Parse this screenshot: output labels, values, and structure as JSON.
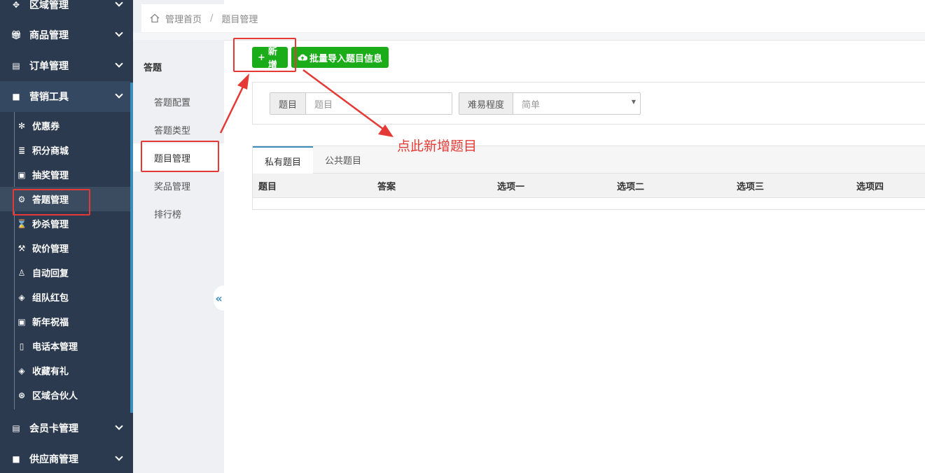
{
  "sidebar": {
    "top_items": [
      {
        "label": "区域管理",
        "icon": "crosshair-icon"
      },
      {
        "label": "商品管理",
        "icon": "gift-icon"
      },
      {
        "label": "订单管理",
        "icon": "list-icon"
      },
      {
        "label": "营销工具",
        "icon": "briefcase-icon"
      }
    ],
    "sub_items": [
      {
        "label": "优惠券",
        "icon": "yelp-icon"
      },
      {
        "label": "积分商城",
        "icon": "database-icon"
      },
      {
        "label": "抽奖管理",
        "icon": "gift-icon"
      },
      {
        "label": "答题管理",
        "icon": "gear-icon"
      },
      {
        "label": "秒杀管理",
        "icon": "hourglass-icon"
      },
      {
        "label": "砍价管理",
        "icon": "gavel-icon"
      },
      {
        "label": "自动回复",
        "icon": "user-icon"
      },
      {
        "label": "组队红包",
        "icon": "tag-icon"
      },
      {
        "label": "新年祝福",
        "icon": "gift-icon"
      },
      {
        "label": "电话本管理",
        "icon": "phone-icon"
      },
      {
        "label": "收藏有礼",
        "icon": "tags-icon"
      },
      {
        "label": "区域合伙人",
        "icon": "dribbble-icon"
      }
    ],
    "bottom_items": [
      {
        "label": "会员卡管理",
        "icon": "id-card-icon"
      },
      {
        "label": "供应商管理",
        "icon": "briefcase-icon"
      }
    ]
  },
  "subnav": {
    "title": "答题",
    "items": [
      "答题配置",
      "答题类型",
      "题目管理",
      "奖品管理",
      "排行榜"
    ],
    "collapse_icon": "«"
  },
  "breadcrumb": {
    "home": "管理首页",
    "separator": "/",
    "current": "题目管理"
  },
  "toolbar": {
    "add_label": "新增",
    "add_icon": "+",
    "import_label": "批量导入题目信息"
  },
  "filters": {
    "question_label": "题目",
    "question_placeholder": "题目",
    "level_label": "难易程度",
    "level_value": "简单",
    "level_caret": "▼"
  },
  "tabs": [
    "私有题目",
    "公共题目"
  ],
  "table": {
    "headers": [
      "题目",
      "答案",
      "选项一",
      "选项二",
      "选项三",
      "选项四"
    ]
  },
  "annotation": {
    "text": "点此新增题目",
    "color": "#e53935"
  }
}
